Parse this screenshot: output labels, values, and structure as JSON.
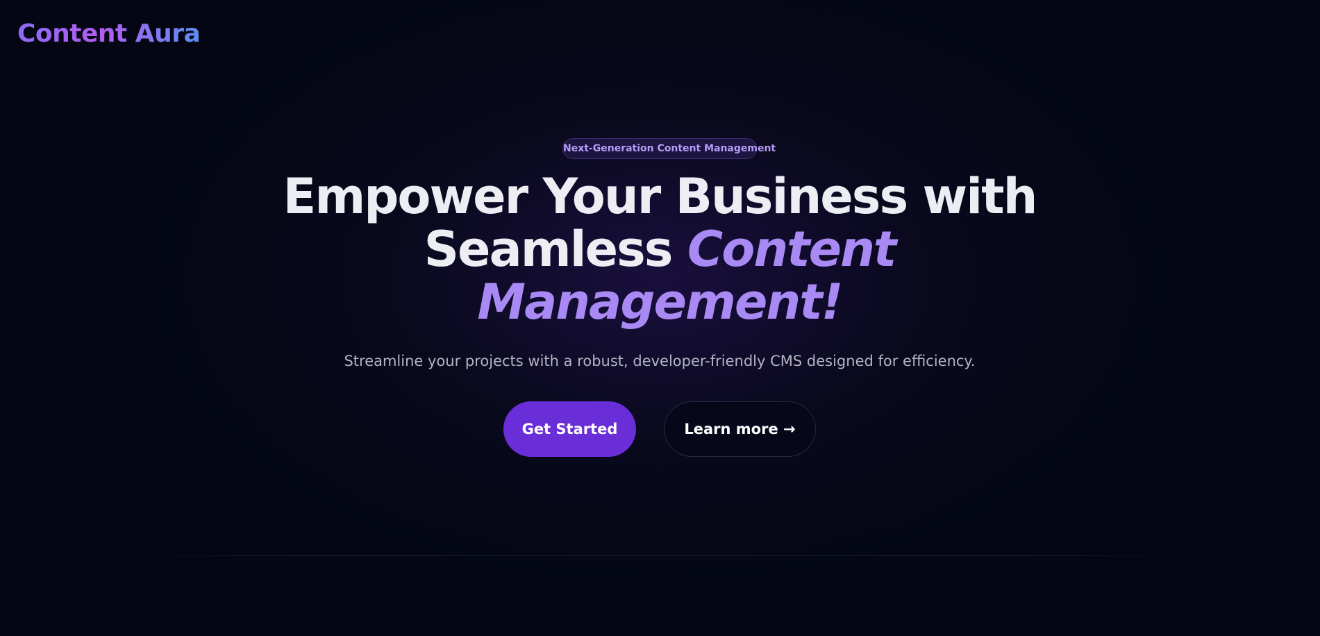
{
  "brand": {
    "name": "Content Aura"
  },
  "hero": {
    "badge": "Next-Generation Content Management",
    "headline_part1": "Empower Your Business with Seamless",
    "headline_accent": "Content Management!",
    "subtitle": "Streamline your projects with a robust, developer-friendly CMS designed for efficiency.",
    "primary_button": "Get Started",
    "secondary_button": "Learn more →"
  },
  "colors": {
    "background": "#040713",
    "accent": "#a98af5",
    "primary_button": "#6a2ed8",
    "badge_text": "#b69cf8"
  }
}
